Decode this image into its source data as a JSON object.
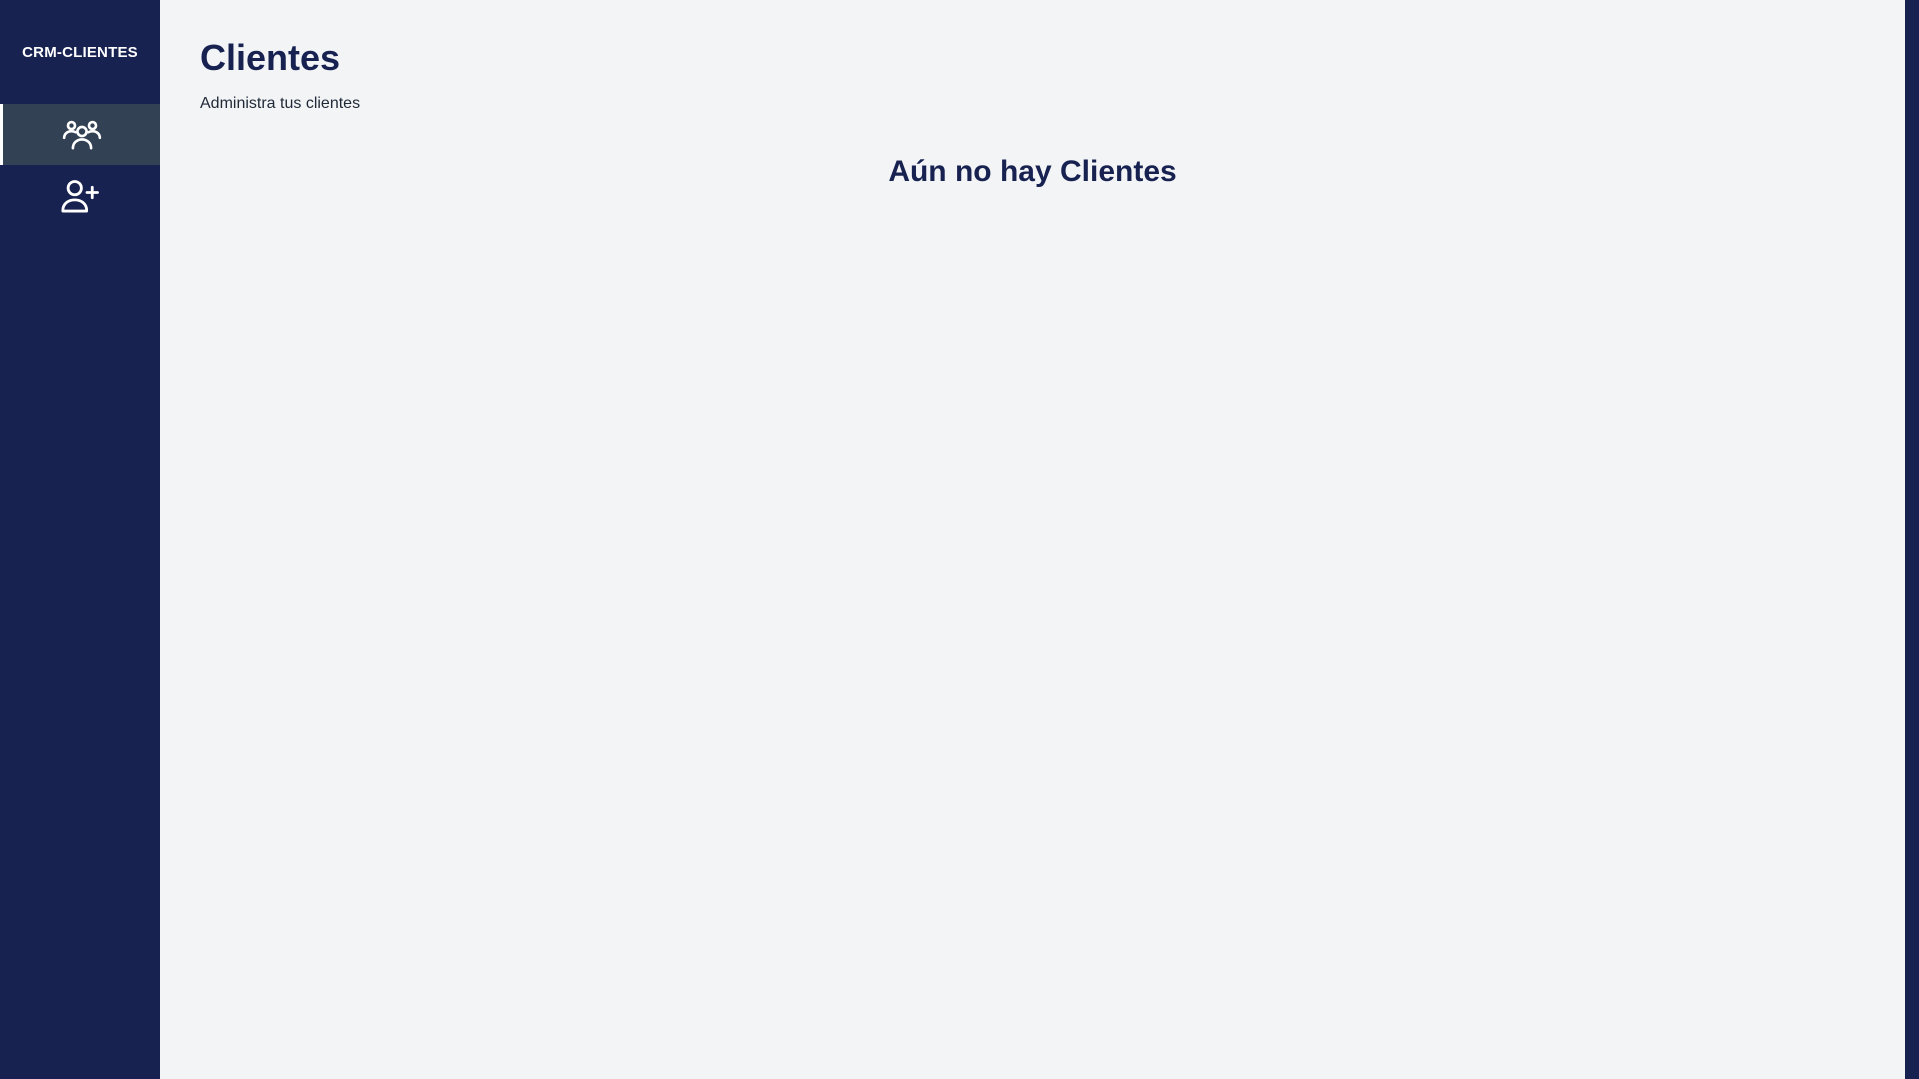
{
  "app": {
    "brand": "CRM-CLIENTES"
  },
  "sidebar": {
    "items": [
      {
        "icon": "users-icon",
        "active": true
      },
      {
        "icon": "user-plus-icon",
        "active": false
      }
    ]
  },
  "main": {
    "title": "Clientes",
    "subtitle": "Administra tus clientes",
    "empty_message": "Aún no hay Clientes"
  },
  "colors": {
    "sidebar_bg": "#172250",
    "active_item_bg": "#334155",
    "content_bg": "#f3f4f6",
    "heading": "#172250"
  }
}
